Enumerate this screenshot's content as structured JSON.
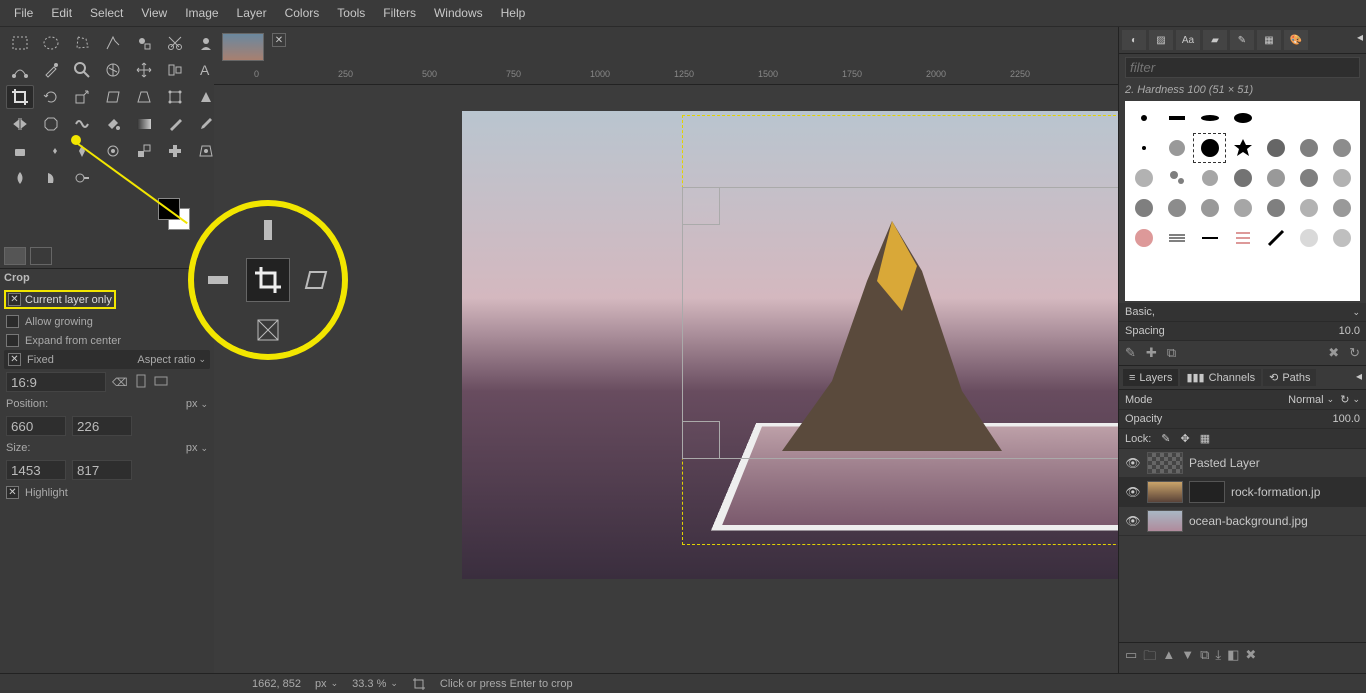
{
  "menu": [
    "File",
    "Edit",
    "Select",
    "View",
    "Image",
    "Layer",
    "Colors",
    "Tools",
    "Filters",
    "Windows",
    "Help"
  ],
  "tool_options": {
    "title": "Crop",
    "current_layer_only": "Current layer only",
    "allow_growing": "Allow growing",
    "expand_from_center": "Expand from center",
    "fixed": "Fixed",
    "fixed_mode": "Aspect ratio",
    "fixed_value": "16:9",
    "position_label": "Position:",
    "position_unit": "px",
    "pos_x": "660",
    "pos_y": "226",
    "size_label": "Size:",
    "size_unit": "px",
    "size_w": "1453",
    "size_h": "817",
    "highlight": "Highlight"
  },
  "ruler_ticks": [
    "0",
    "250",
    "500",
    "750",
    "1000",
    "1250",
    "1500",
    "1750",
    "2000",
    "2250"
  ],
  "status": {
    "coords": "1662, 852",
    "unit": "px",
    "zoom": "33.3 %",
    "hint": "Click or press Enter to crop"
  },
  "brushes": {
    "filter_placeholder": "filter",
    "title": "2. Hardness 100 (51 × 51)",
    "preset": "Basic,",
    "spacing_label": "Spacing",
    "spacing_value": "10.0"
  },
  "layers": {
    "tab_layers": "Layers",
    "tab_channels": "Channels",
    "tab_paths": "Paths",
    "mode_label": "Mode",
    "mode_value": "Normal",
    "opacity_label": "Opacity",
    "opacity_value": "100.0",
    "lock_label": "Lock:",
    "items": [
      {
        "name": "Pasted Layer"
      },
      {
        "name": "rock-formation.jp"
      },
      {
        "name": "ocean-background.jpg"
      }
    ]
  }
}
